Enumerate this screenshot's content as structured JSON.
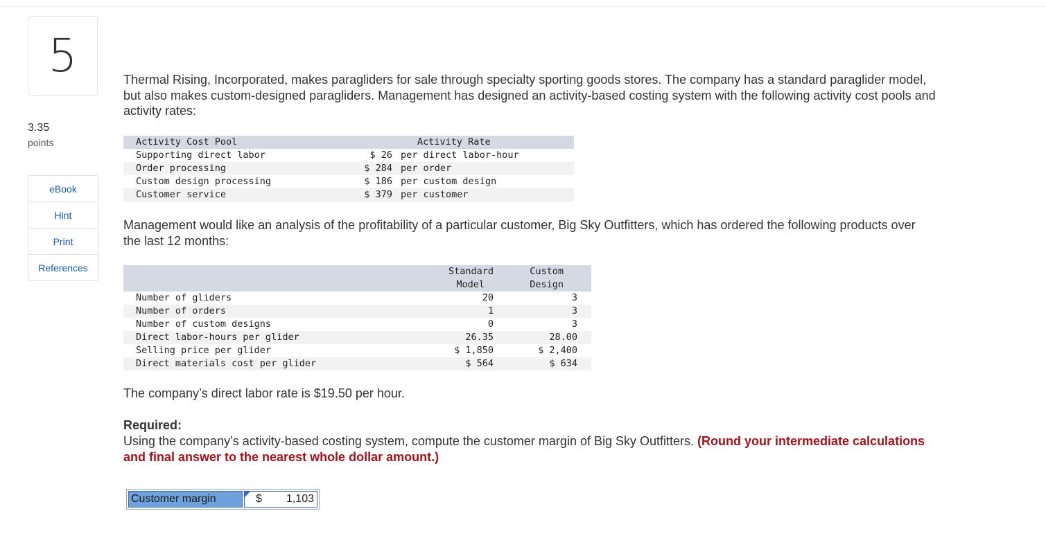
{
  "question": {
    "number": "5",
    "points_value": "3.35",
    "points_label": "points"
  },
  "side_menu": [
    "eBook",
    "Hint",
    "Print",
    "References"
  ],
  "intro": "Thermal Rising, Incorporated, makes paragliders for sale through specialty sporting goods stores. The company has a standard paraglider model, but also makes custom-designed paragliders. Management has designed an activity-based costing system with the following activity cost pools and activity rates:",
  "activity_table": {
    "header_pool": "Activity Cost Pool",
    "header_rate": "Activity Rate",
    "rows": [
      {
        "pool": "Supporting direct labor",
        "amount": "$ 26",
        "unit": "per direct labor-hour"
      },
      {
        "pool": "Order processing",
        "amount": "$ 284",
        "unit": "per order"
      },
      {
        "pool": "Custom design processing",
        "amount": "$ 186",
        "unit": "per custom design"
      },
      {
        "pool": "Customer service",
        "amount": "$ 379",
        "unit": "per customer"
      }
    ]
  },
  "analysis_text": "Management would like an analysis of the profitability of a particular customer, Big Sky Outfitters, which has ordered the following products over the last 12 months:",
  "product_table": {
    "header_standard_1": "Standard",
    "header_standard_2": "Model",
    "header_custom_1": "Custom",
    "header_custom_2": "Design",
    "rows": [
      {
        "label": "Number of gliders",
        "standard": "20",
        "custom": "3"
      },
      {
        "label": "Number of orders",
        "standard": "1",
        "custom": "3"
      },
      {
        "label": "Number of custom designs",
        "standard": "0",
        "custom": "3"
      },
      {
        "label": "Direct labor-hours per glider",
        "standard": "26.35",
        "custom": "28.00"
      },
      {
        "label": "Selling price per glider",
        "standard": "$ 1,850",
        "custom": "$ 2,400"
      },
      {
        "label": "Direct materials cost per glider",
        "standard": "$ 564",
        "custom": "$ 634"
      }
    ]
  },
  "labor_rate_text": "The company’s direct labor rate is $19.50 per hour.",
  "required": {
    "title": "Required:",
    "text": "Using the company’s activity-based costing system, compute the customer margin of Big Sky Outfitters. ",
    "note": "(Round your intermediate calculations and final answer to the nearest whole dollar amount.)"
  },
  "answer": {
    "label": "Customer margin",
    "currency": "$",
    "value": "1,103"
  }
}
